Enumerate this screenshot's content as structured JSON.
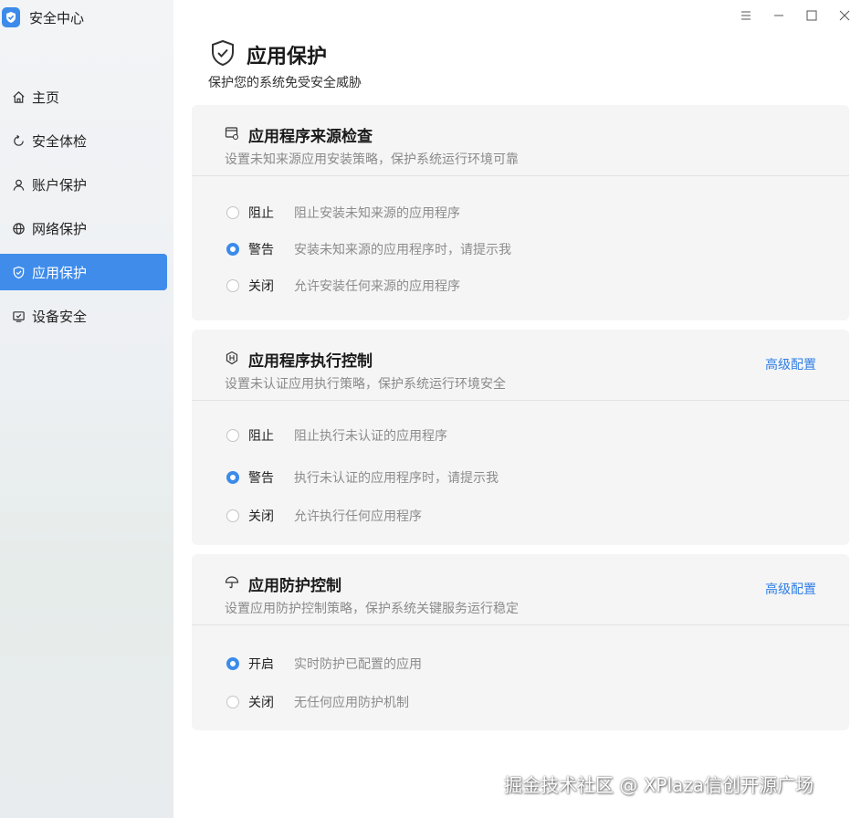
{
  "app": {
    "title": "安全中心"
  },
  "sidebar": {
    "items": [
      {
        "label": "主页",
        "icon": "home-icon"
      },
      {
        "label": "安全体检",
        "icon": "refresh-icon"
      },
      {
        "label": "账户保护",
        "icon": "user-icon"
      },
      {
        "label": "网络保护",
        "icon": "globe-icon"
      },
      {
        "label": "应用保护",
        "icon": "shield-check-icon",
        "active": true
      },
      {
        "label": "设备安全",
        "icon": "device-check-icon"
      }
    ]
  },
  "window_controls": [
    "menu-icon",
    "minimize-icon",
    "maximize-icon",
    "close-icon"
  ],
  "page": {
    "title": "应用保护",
    "subtitle": "保护您的系统免受安全威胁"
  },
  "cards": [
    {
      "title": "应用程序来源检查",
      "description": "设置未知来源应用安装策略，保护系统运行环境可靠",
      "options": [
        {
          "name": "阻止",
          "desc": "阻止安装未知来源的应用程序",
          "selected": false
        },
        {
          "name": "警告",
          "desc": "安装未知来源的应用程序时，请提示我",
          "selected": true
        },
        {
          "name": "关闭",
          "desc": "允许安装任何来源的应用程序",
          "selected": false
        }
      ]
    },
    {
      "title": "应用程序执行控制",
      "description": "设置未认证应用执行策略，保护系统运行环境安全",
      "link": "高级配置",
      "options": [
        {
          "name": "阻止",
          "desc": "阻止执行未认证的应用程序",
          "selected": false
        },
        {
          "name": "警告",
          "desc": "执行未认证的应用程序时，请提示我",
          "selected": true
        },
        {
          "name": "关闭",
          "desc": "允许执行任何应用程序",
          "selected": false
        }
      ]
    },
    {
      "title": "应用防护控制",
      "description": "设置应用防护控制策略，保护系统关键服务运行稳定",
      "link": "高级配置",
      "options": [
        {
          "name": "开启",
          "desc": "实时防护已配置的应用",
          "selected": true
        },
        {
          "name": "关闭",
          "desc": "无任何应用防护机制",
          "selected": false
        }
      ]
    }
  ],
  "watermark": "掘金技术社区 @ XPlaza信创开源广场",
  "colors": {
    "accent": "#3c8bea",
    "link": "#2f7fe6",
    "card_bg": "#f5f5f5"
  }
}
